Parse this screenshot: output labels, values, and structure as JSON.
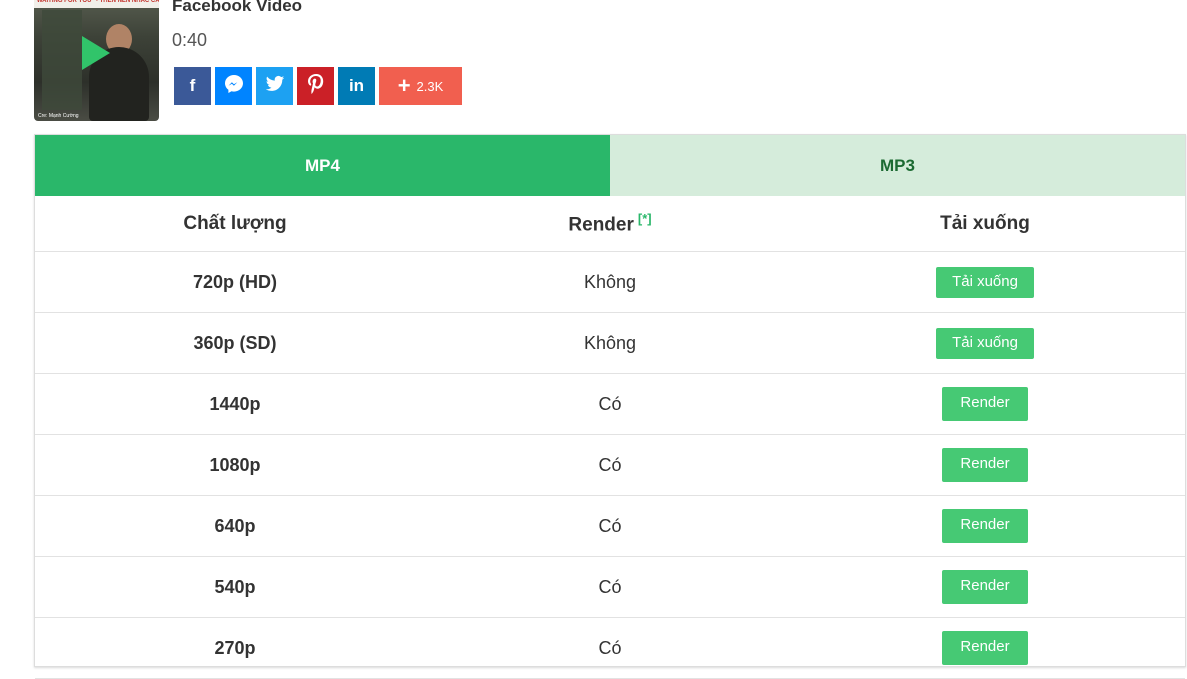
{
  "video": {
    "thumbnail_banner": "\"WAITING FOR YOU\" - THEN NEN NHAC CACH MANG",
    "thumbnail_credit": "Cre: Mạnh Cường",
    "title": "Facebook Video",
    "duration": "0:40"
  },
  "share": {
    "buttons": [
      {
        "name": "facebook",
        "glyph": "f",
        "color": "#3b5998"
      },
      {
        "name": "messenger",
        "glyph": "✉",
        "color": "#0084ff"
      },
      {
        "name": "twitter",
        "glyph": "t",
        "color": "#1da1f2"
      },
      {
        "name": "pinterest",
        "glyph": "P",
        "color": "#cb2027"
      },
      {
        "name": "linkedin",
        "glyph": "in",
        "color": "#007bb5"
      }
    ],
    "more_count": "2.3K",
    "more_color": "#f15f4f"
  },
  "tabs": {
    "mp4": "MP4",
    "mp3": "MP3"
  },
  "table": {
    "headers": {
      "quality": "Chất lượng",
      "render": "Render",
      "render_note": "[*]",
      "download": "Tải xuống"
    },
    "rows": [
      {
        "quality": "720p (HD)",
        "render": "Không",
        "action": "Tải xuống"
      },
      {
        "quality": "360p (SD)",
        "render": "Không",
        "action": "Tải xuống"
      },
      {
        "quality": "1440p",
        "render": "Có",
        "action": "Render"
      },
      {
        "quality": "1080p",
        "render": "Có",
        "action": "Render"
      },
      {
        "quality": "640p",
        "render": "Có",
        "action": "Render"
      },
      {
        "quality": "540p",
        "render": "Có",
        "action": "Render"
      },
      {
        "quality": "270p",
        "render": "Có",
        "action": "Render"
      }
    ]
  },
  "colors": {
    "accent_green": "#2ab76a",
    "button_green": "#46c974",
    "inactive_tab": "#d5ecdb"
  }
}
